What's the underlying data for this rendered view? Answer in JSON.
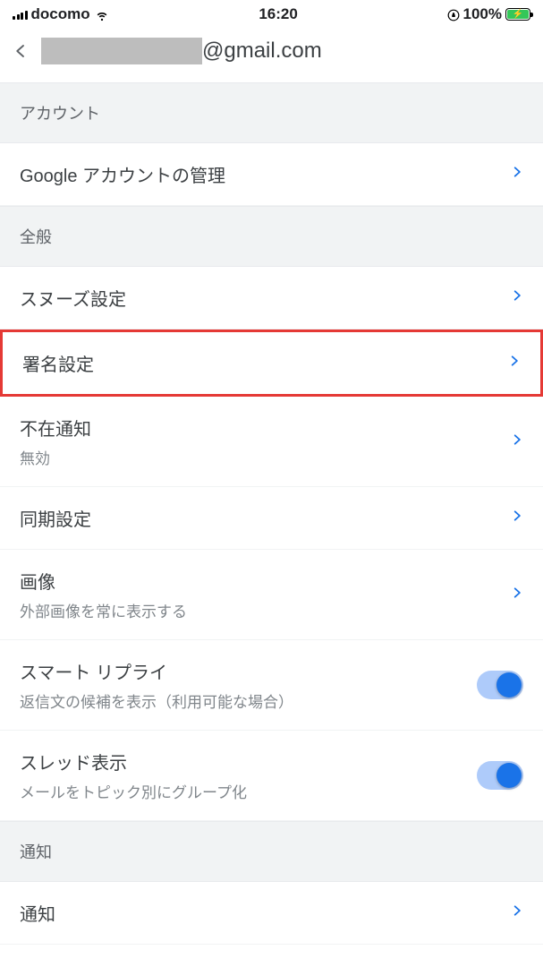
{
  "status": {
    "carrier": "docomo",
    "time": "16:20",
    "battery_pct": "100%"
  },
  "header": {
    "email_suffix": "@gmail.com"
  },
  "sections": {
    "account": {
      "label": "アカウント"
    },
    "general": {
      "label": "全般"
    },
    "notifications": {
      "label": "通知"
    }
  },
  "rows": {
    "manage_account": {
      "title": "Google アカウントの管理"
    },
    "snooze": {
      "title": "スヌーズ設定"
    },
    "signature": {
      "title": "署名設定"
    },
    "ooo": {
      "title": "不在通知",
      "sub": "無効"
    },
    "sync": {
      "title": "同期設定"
    },
    "images": {
      "title": "画像",
      "sub": "外部画像を常に表示する"
    },
    "smart_reply": {
      "title": "スマート リプライ",
      "sub": "返信文の候補を表示（利用可能な場合）",
      "enabled": true
    },
    "thread": {
      "title": "スレッド表示",
      "sub": "メールをトピック別にグループ化",
      "enabled": true
    },
    "notify": {
      "title": "通知"
    }
  }
}
